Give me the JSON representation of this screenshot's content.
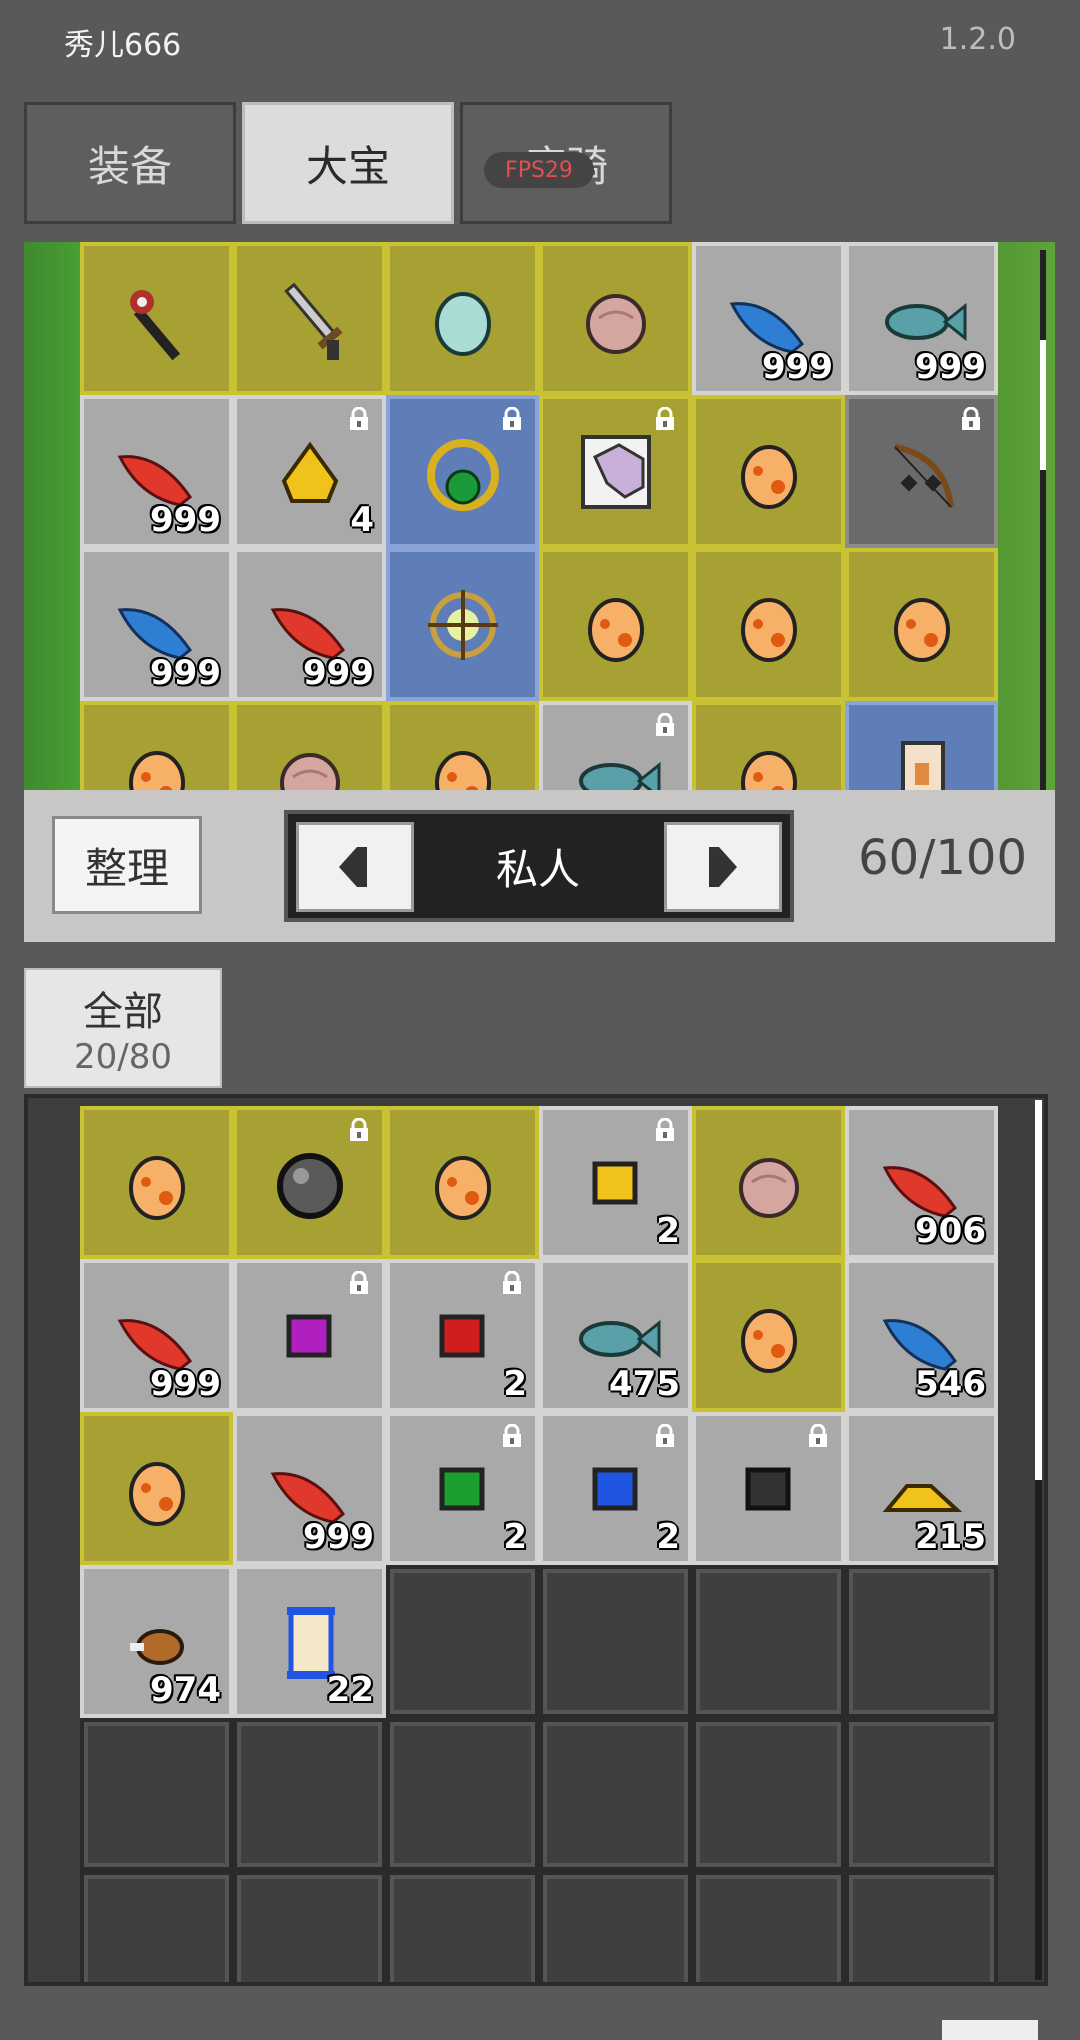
{
  "header": {
    "player_name": "秀儿666",
    "version": "1.2.0"
  },
  "tabs": [
    {
      "label": "装备",
      "active": false
    },
    {
      "label": "大宝",
      "active": true
    },
    {
      "label": "座骑",
      "active": false
    }
  ],
  "fps_badge": "FPS29",
  "bank": {
    "rows": [
      [
        {
          "item": "staff",
          "style": "gold"
        },
        {
          "item": "sword",
          "style": "gold"
        },
        {
          "item": "teal-egg",
          "style": "gold"
        },
        {
          "item": "pink-shell",
          "style": "gold"
        },
        {
          "item": "blue-feather",
          "style": "gray",
          "count": "999"
        },
        {
          "item": "fish",
          "style": "gray",
          "count": "999"
        }
      ],
      [
        {
          "item": "red-feather",
          "style": "gray",
          "count": "999"
        },
        {
          "item": "gold-nugget",
          "style": "gray",
          "count": "4",
          "locked": true
        },
        {
          "item": "emerald-ring",
          "style": "blue",
          "locked": true
        },
        {
          "item": "horse-portrait",
          "style": "gold",
          "locked": true
        },
        {
          "item": "spotted-egg",
          "style": "gold"
        },
        {
          "item": "bow",
          "style": "dark",
          "locked": true
        }
      ],
      [
        {
          "item": "blue-feather",
          "style": "gray",
          "count": "999"
        },
        {
          "item": "red-feather",
          "style": "gray",
          "count": "999"
        },
        {
          "item": "gold-emblem",
          "style": "blue"
        },
        {
          "item": "spotted-egg",
          "style": "gold"
        },
        {
          "item": "spotted-egg",
          "style": "gold"
        },
        {
          "item": "spotted-egg",
          "style": "gold"
        }
      ],
      [
        {
          "item": "spotted-egg",
          "style": "gold"
        },
        {
          "item": "pink-shell",
          "style": "gold"
        },
        {
          "item": "spotted-egg",
          "style": "gold"
        },
        {
          "item": "fish",
          "style": "gray",
          "locked": true
        },
        {
          "item": "spotted-egg",
          "style": "gold"
        },
        {
          "item": "scroll",
          "style": "blue"
        }
      ]
    ]
  },
  "controls": {
    "sort_label": "整理",
    "pager_label": "私人",
    "capacity": "60/100"
  },
  "bag_tab": {
    "label": "全部",
    "count": "20/80"
  },
  "bag": {
    "rows": [
      [
        {
          "item": "spotted-egg",
          "style": "gold"
        },
        {
          "item": "dark-orb",
          "style": "gold",
          "locked": true
        },
        {
          "item": "spotted-egg",
          "style": "gold"
        },
        {
          "item": "gold-gem",
          "style": "gray",
          "count": "2",
          "locked": true
        },
        {
          "item": "pink-shell",
          "style": "gold"
        },
        {
          "item": "red-feather",
          "style": "gray",
          "count": "906"
        }
      ],
      [
        {
          "item": "red-feather",
          "style": "gray",
          "count": "999"
        },
        {
          "item": "purple-gem",
          "style": "gray",
          "locked": true
        },
        {
          "item": "red-gem",
          "style": "gray",
          "count": "2",
          "locked": true
        },
        {
          "item": "fish",
          "style": "gray",
          "count": "475"
        },
        {
          "item": "spotted-egg",
          "style": "gold"
        },
        {
          "item": "blue-feather",
          "style": "gray",
          "count": "546"
        }
      ],
      [
        {
          "item": "spotted-egg",
          "style": "gold"
        },
        {
          "item": "red-feather",
          "style": "gray",
          "count": "999"
        },
        {
          "item": "green-gem",
          "style": "gray",
          "count": "2",
          "locked": true
        },
        {
          "item": "blue-gem",
          "style": "gray",
          "count": "2",
          "locked": true
        },
        {
          "item": "black-gem",
          "style": "gray",
          "locked": true
        },
        {
          "item": "gold-pile",
          "style": "gray",
          "count": "215"
        }
      ],
      [
        {
          "item": "meat",
          "style": "gray",
          "count": "974"
        },
        {
          "item": "scroll-blue",
          "style": "gray",
          "count": "22"
        },
        {
          "item": "empty",
          "style": "empty"
        },
        {
          "item": "empty",
          "style": "empty"
        },
        {
          "item": "empty",
          "style": "empty"
        },
        {
          "item": "empty",
          "style": "empty"
        }
      ],
      [
        {
          "item": "empty",
          "style": "empty"
        },
        {
          "item": "empty",
          "style": "empty"
        },
        {
          "item": "empty",
          "style": "empty"
        },
        {
          "item": "empty",
          "style": "empty"
        },
        {
          "item": "empty",
          "style": "empty"
        },
        {
          "item": "empty",
          "style": "empty"
        }
      ],
      [
        {
          "item": "empty",
          "style": "empty"
        },
        {
          "item": "empty",
          "style": "empty"
        },
        {
          "item": "empty",
          "style": "empty"
        },
        {
          "item": "empty",
          "style": "empty"
        },
        {
          "item": "empty",
          "style": "empty"
        },
        {
          "item": "empty",
          "style": "empty"
        }
      ]
    ]
  }
}
